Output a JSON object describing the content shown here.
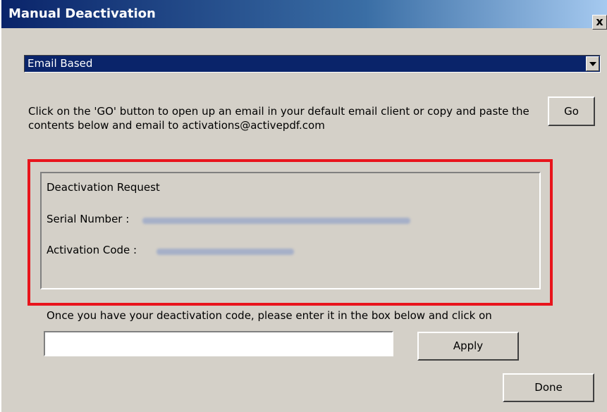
{
  "window": {
    "title": "Manual Deactivation",
    "close_label": "x"
  },
  "method": {
    "selected": "Email Based"
  },
  "instructions": "Click on the 'GO' button to open up an email in your default email client or copy and paste the contents below and email to activations@activepdf.com",
  "go_button": "Go",
  "request": {
    "heading": "Deactivation Request",
    "serial_label": "Serial Number :",
    "activation_label": "Activation Code :"
  },
  "prompt": "Once you have your deactivation code, please enter it in the box below and click on",
  "code_input": {
    "value": "",
    "placeholder": ""
  },
  "apply_button": "Apply",
  "done_button": "Done",
  "colors": {
    "title_bar": "#0a246a",
    "highlight": "#e8141c",
    "window_bg": "#d4d0c8"
  }
}
